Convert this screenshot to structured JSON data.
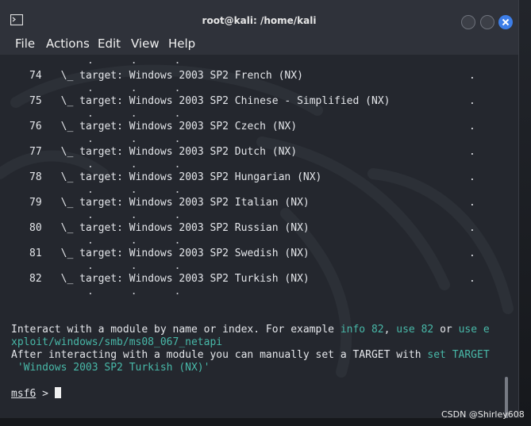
{
  "window": {
    "title": "root@kali: /home/kali"
  },
  "menu": [
    "File",
    "Actions",
    "Edit",
    "View",
    "Help"
  ],
  "dot_row": ".      .      .",
  "rows": [
    {
      "index": "74",
      "target": "Windows 2003 SP2 French (NX)",
      "tail": "."
    },
    {
      "index": "75",
      "target": "Windows 2003 SP2 Chinese - Simplified (NX)",
      "tail": "."
    },
    {
      "index": "76",
      "target": "Windows 2003 SP2 Czech (NX)",
      "tail": "."
    },
    {
      "index": "77",
      "target": "Windows 2003 SP2 Dutch (NX)",
      "tail": "."
    },
    {
      "index": "78",
      "target": "Windows 2003 SP2 Hungarian (NX)",
      "tail": "."
    },
    {
      "index": "79",
      "target": "Windows 2003 SP2 Italian (NX)",
      "tail": "."
    },
    {
      "index": "80",
      "target": "Windows 2003 SP2 Russian (NX)",
      "tail": "."
    },
    {
      "index": "81",
      "target": "Windows 2003 SP2 Swedish (NX)",
      "tail": "."
    },
    {
      "index": "82",
      "target": "Windows 2003 SP2 Turkish (NX)",
      "tail": "."
    }
  ],
  "row_prefix": "\\_ target: ",
  "help": {
    "line1_text": "Interact with a module by name or index. For example ",
    "line1_cmd1": "info 82",
    "line1_sep1": ", ",
    "line1_cmd2": "use 82",
    "line1_sep2": " or ",
    "line1_cmd3a": "use e",
    "line2_cmd3b": "xploit/windows/smb/ms08_067_netapi",
    "line3_text": "After interacting with a module you can manually set a TARGET with ",
    "line3_cmd": "set TARGET",
    "line4_cmd": " 'Windows 2003 SP2 Turkish (NX)'"
  },
  "prompt": {
    "label": "msf6",
    "symbol": " > "
  },
  "watermark": "CSDN @Shirley608",
  "colors": {
    "command_teal": "#48b8a8",
    "close_button": "#3d7ee8",
    "terminal_bg": "#24272e"
  }
}
